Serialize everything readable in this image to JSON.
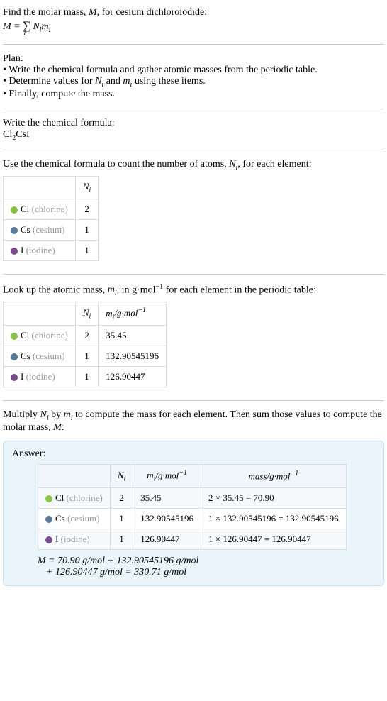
{
  "intro": {
    "line1": "Find the molar mass, M, for cesium dichloroiodide:",
    "formula": "M = ∑",
    "formula_sub": "i",
    "formula_rest": " Nᵢmᵢ"
  },
  "plan": {
    "title": "Plan:",
    "items": [
      "• Write the chemical formula and gather atomic masses from the periodic table.",
      "• Determine values for Nᵢ and mᵢ using these items.",
      "• Finally, compute the mass."
    ]
  },
  "step1": {
    "title": "Write the chemical formula:",
    "formula": "Cl₂CsI"
  },
  "step2": {
    "title": "Use the chemical formula to count the number of atoms, Nᵢ, for each element:",
    "header_n": "Nᵢ",
    "rows": [
      {
        "symbol": "Cl",
        "name": "(chlorine)",
        "n": "2",
        "dot": "dot-green"
      },
      {
        "symbol": "Cs",
        "name": "(cesium)",
        "n": "1",
        "dot": "dot-blue"
      },
      {
        "symbol": "I",
        "name": "(iodine)",
        "n": "1",
        "dot": "dot-purple"
      }
    ]
  },
  "step3": {
    "title": "Look up the atomic mass, mᵢ, in g·mol⁻¹ for each element in the periodic table:",
    "header_n": "Nᵢ",
    "header_m": "mᵢ/g·mol⁻¹",
    "rows": [
      {
        "symbol": "Cl",
        "name": "(chlorine)",
        "n": "2",
        "m": "35.45",
        "dot": "dot-green"
      },
      {
        "symbol": "Cs",
        "name": "(cesium)",
        "n": "1",
        "m": "132.90545196",
        "dot": "dot-blue"
      },
      {
        "symbol": "I",
        "name": "(iodine)",
        "n": "1",
        "m": "126.90447",
        "dot": "dot-purple"
      }
    ]
  },
  "step4": {
    "title": "Multiply Nᵢ by mᵢ to compute the mass for each element. Then sum those values to compute the molar mass, M:"
  },
  "answer": {
    "title": "Answer:",
    "header_n": "Nᵢ",
    "header_m": "mᵢ/g·mol⁻¹",
    "header_mass": "mass/g·mol⁻¹",
    "rows": [
      {
        "symbol": "Cl",
        "name": "(chlorine)",
        "n": "2",
        "m": "35.45",
        "mass": "2 × 35.45 = 70.90",
        "dot": "dot-green"
      },
      {
        "symbol": "Cs",
        "name": "(cesium)",
        "n": "1",
        "m": "132.90545196",
        "mass": "1 × 132.90545196 = 132.90545196",
        "dot": "dot-blue"
      },
      {
        "symbol": "I",
        "name": "(iodine)",
        "n": "1",
        "m": "126.90447",
        "mass": "1 × 126.90447 = 126.90447",
        "dot": "dot-purple"
      }
    ],
    "final1": "M = 70.90 g/mol + 132.90545196 g/mol",
    "final2": "+ 126.90447 g/mol = 330.71 g/mol"
  }
}
